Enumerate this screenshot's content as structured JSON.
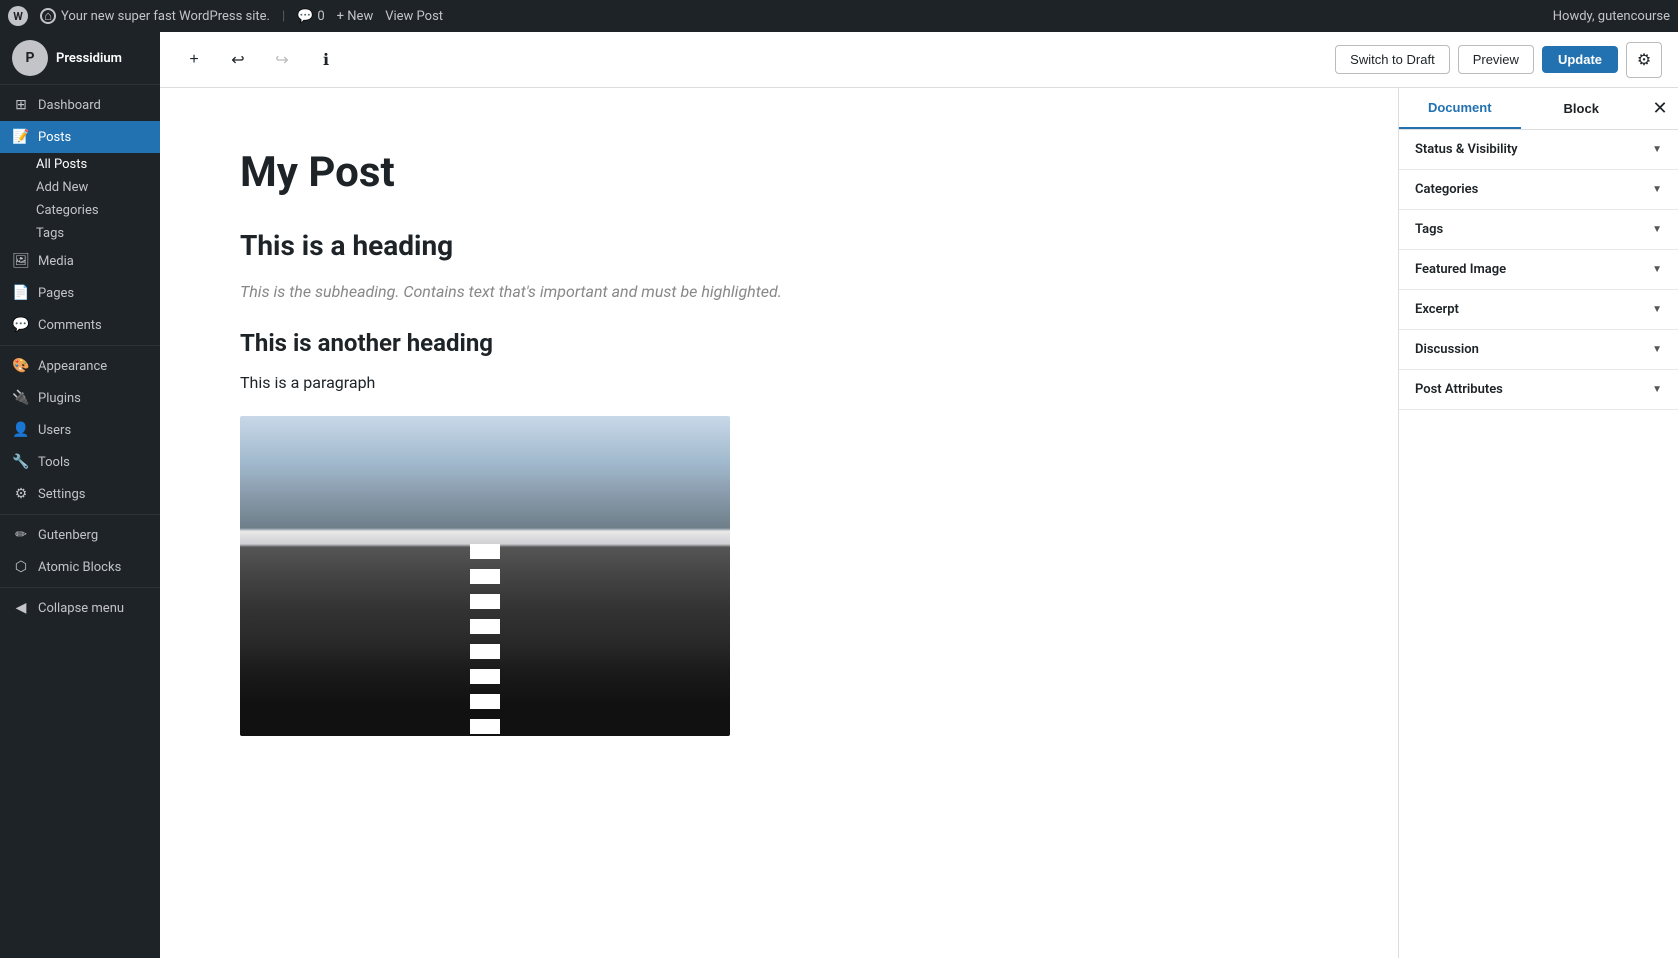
{
  "adminBar": {
    "wpLogo": "W",
    "siteIcon": "⌂",
    "siteName": "Your new super fast WordPress site.",
    "commentsIcon": "💬",
    "commentsCount": "0",
    "newLabel": "+ New",
    "viewPost": "View Post",
    "howdy": "Howdy, gutencourse"
  },
  "sidebar": {
    "logoText": "P",
    "siteName": "Pressidium",
    "items": [
      {
        "id": "dashboard",
        "label": "Dashboard",
        "icon": "⊞"
      },
      {
        "id": "posts",
        "label": "Posts",
        "icon": "📝",
        "active": true
      },
      {
        "id": "media",
        "label": "Media",
        "icon": "🖼"
      },
      {
        "id": "pages",
        "label": "Pages",
        "icon": "📄"
      },
      {
        "id": "comments",
        "label": "Comments",
        "icon": "💬"
      },
      {
        "id": "appearance",
        "label": "Appearance",
        "icon": "🎨"
      },
      {
        "id": "plugins",
        "label": "Plugins",
        "icon": "🔌"
      },
      {
        "id": "users",
        "label": "Users",
        "icon": "👤"
      },
      {
        "id": "tools",
        "label": "Tools",
        "icon": "🔧"
      },
      {
        "id": "settings",
        "label": "Settings",
        "icon": "⚙"
      },
      {
        "id": "gutenberg",
        "label": "Gutenberg",
        "icon": "✏"
      },
      {
        "id": "atomic-blocks",
        "label": "Atomic Blocks",
        "icon": "⬡"
      }
    ],
    "postsSubmenu": [
      {
        "id": "all-posts",
        "label": "All Posts",
        "active": true
      },
      {
        "id": "add-new",
        "label": "Add New"
      },
      {
        "id": "categories",
        "label": "Categories"
      },
      {
        "id": "tags",
        "label": "Tags"
      }
    ],
    "collapseMenu": "Collapse menu"
  },
  "toolbar": {
    "addBlockLabel": "+",
    "undoLabel": "↩",
    "redoLabel": "↪",
    "infoLabel": "ℹ",
    "switchToDraft": "Switch to Draft",
    "preview": "Preview",
    "update": "Update",
    "settingsIcon": "⚙"
  },
  "editor": {
    "postTitle": "My Post",
    "heading1": "This is a heading",
    "subheading": "This is the subheading. Contains text that's important and must be highlighted.",
    "heading2": "This is another heading",
    "paragraph": "This is a paragraph"
  },
  "panel": {
    "documentTab": "Document",
    "blockTab": "Block",
    "closeIcon": "✕",
    "sections": [
      {
        "id": "status-visibility",
        "label": "Status & Visibility"
      },
      {
        "id": "categories",
        "label": "Categories"
      },
      {
        "id": "tags",
        "label": "Tags"
      },
      {
        "id": "featured-image",
        "label": "Featured Image"
      },
      {
        "id": "excerpt",
        "label": "Excerpt"
      },
      {
        "id": "discussion",
        "label": "Discussion"
      },
      {
        "id": "post-attributes",
        "label": "Post Attributes"
      }
    ]
  }
}
